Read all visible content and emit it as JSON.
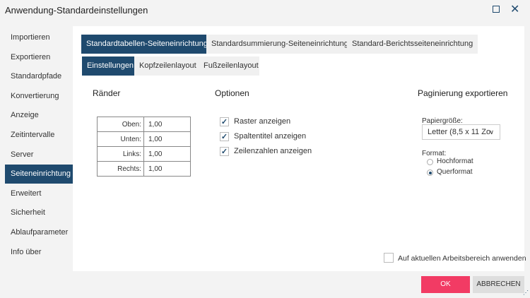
{
  "title": "Anwendung-Standardeinstellungen",
  "sidebar": [
    "Importieren",
    "Exportieren",
    "Standardpfade",
    "Konvertierung",
    "Anzeige",
    "Zeitintervalle",
    "Server",
    "Seiteneinrichtung",
    "Erweitert",
    "Sicherheit",
    "Ablaufparameter",
    "Info über"
  ],
  "tabs": [
    "Standardtabellen-Seiteneinrichtung",
    "Standardsummierung-Seiteneinrichtung",
    "Standard-Berichtsseiteneinrichtung"
  ],
  "subtabs": [
    "Einstellungen",
    "Kopfzeilenlayout",
    "Fußzeilenlayout"
  ],
  "margins": {
    "heading": "Ränder",
    "rows": [
      {
        "label": "Oben:",
        "value": "1,00"
      },
      {
        "label": "Unten:",
        "value": "1,00"
      },
      {
        "label": "Links:",
        "value": "1,00"
      },
      {
        "label": "Rechts:",
        "value": "1,00"
      }
    ]
  },
  "options": {
    "heading": "Optionen",
    "items": [
      {
        "label": "Raster anzeigen",
        "checked": true
      },
      {
        "label": "Spaltentitel anzeigen",
        "checked": true
      },
      {
        "label": "Zeilenzahlen anzeigen",
        "checked": true
      }
    ]
  },
  "pagination": {
    "heading": "Paginierung exportieren",
    "paper_label": "Papiergröße:",
    "paper_value": "Letter (8,5 x 11 Zo",
    "format_label": "Format:",
    "portrait": "Hochformat",
    "landscape": "Querformat",
    "selected": "Querformat"
  },
  "apply_label": "Auf aktuellen Arbeitsbereich anwenden",
  "ok": "OK",
  "cancel": "ABBRECHEN",
  "colors": {
    "accent": "#1f4a6e",
    "ok": "#f23b64"
  }
}
